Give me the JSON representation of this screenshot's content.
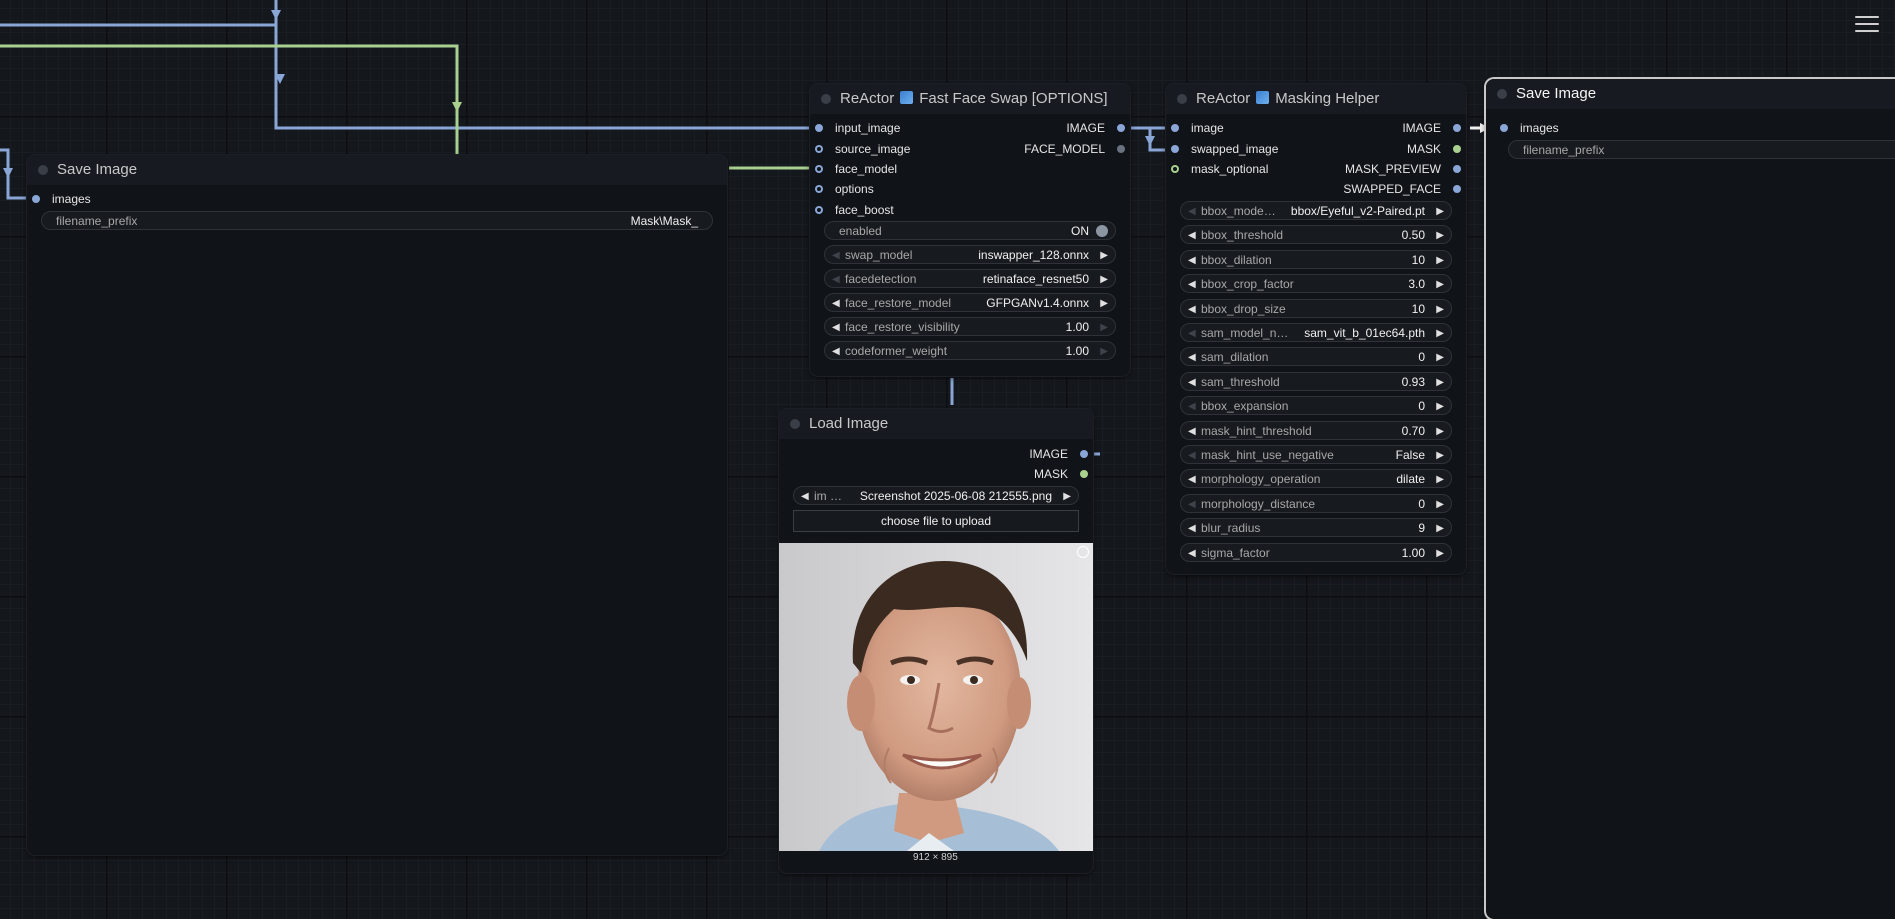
{
  "canvas": {
    "menu_icon": "hamburger-menu-icon"
  },
  "colors": {
    "image_link": "#8aa6d6",
    "mask_link": "#a9d08f",
    "node_bg": "#101318",
    "title_bg": "#171b21"
  },
  "save_image_left": {
    "title": "Save Image",
    "input": "images",
    "widget": {
      "label": "filename_prefix",
      "value": "Mask\\Mask_"
    }
  },
  "reactor_swap": {
    "title_prefix": "ReActor",
    "title_suffix": "Fast Face Swap [OPTIONS]",
    "inputs": [
      "input_image",
      "source_image",
      "face_model",
      "options",
      "face_boost"
    ],
    "outputs": [
      "IMAGE",
      "FACE_MODEL"
    ],
    "enabled": {
      "label": "enabled",
      "value": "ON"
    },
    "widgets": [
      {
        "label": "swap_model",
        "value": "inswapper_128.onnx"
      },
      {
        "label": "facedetection",
        "value": "retinaface_resnet50"
      },
      {
        "label": "face_restore_model",
        "value": "GFPGANv1.4.onnx"
      },
      {
        "label": "face_restore_visibility",
        "value": "1.00"
      },
      {
        "label": "codeformer_weight",
        "value": "1.00"
      }
    ]
  },
  "reactor_mask": {
    "title_prefix": "ReActor",
    "title_suffix": "Masking Helper",
    "inputs": [
      "image",
      "swapped_image",
      "mask_optional"
    ],
    "outputs": [
      "IMAGE",
      "MASK",
      "MASK_PREVIEW",
      "SWAPPED_FACE"
    ],
    "widgets": [
      {
        "label": "bbox_mode…",
        "value": "bbox/Eyeful_v2-Paired.pt"
      },
      {
        "label": "bbox_threshold",
        "value": "0.50"
      },
      {
        "label": "bbox_dilation",
        "value": "10"
      },
      {
        "label": "bbox_crop_factor",
        "value": "3.0"
      },
      {
        "label": "bbox_drop_size",
        "value": "10"
      },
      {
        "label": "sam_model_n…",
        "value": "sam_vit_b_01ec64.pth"
      },
      {
        "label": "sam_dilation",
        "value": "0"
      },
      {
        "label": "sam_threshold",
        "value": "0.93"
      },
      {
        "label": "bbox_expansion",
        "value": "0"
      },
      {
        "label": "mask_hint_threshold",
        "value": "0.70"
      },
      {
        "label": "mask_hint_use_negative",
        "value": "False"
      },
      {
        "label": "morphology_operation",
        "value": "dilate"
      },
      {
        "label": "morphology_distance",
        "value": "0"
      },
      {
        "label": "blur_radius",
        "value": "9"
      },
      {
        "label": "sigma_factor",
        "value": "1.00"
      }
    ]
  },
  "load_image": {
    "title": "Load Image",
    "outputs": [
      "IMAGE",
      "MASK"
    ],
    "image_widget": {
      "label": "im …",
      "value": "Screenshot 2025-06-08 212555.png"
    },
    "upload_label": "choose file to upload",
    "dimensions": "912 × 895",
    "preview_icon": "expand-preview-icon"
  },
  "save_image_right": {
    "title": "Save Image",
    "input": "images",
    "widget": {
      "label": "filename_prefix"
    }
  }
}
